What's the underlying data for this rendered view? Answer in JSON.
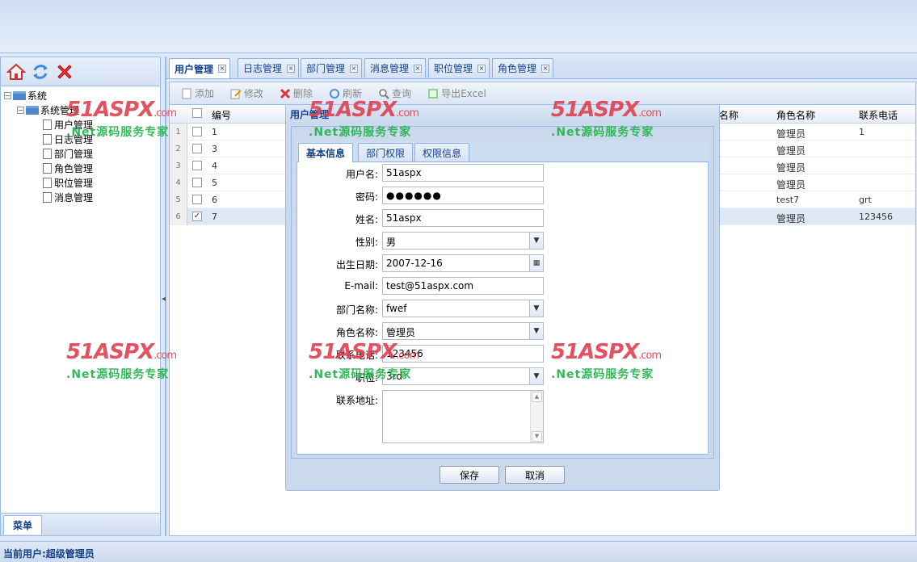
{
  "left": {
    "tree": {
      "root": "系统",
      "group": "系统管理",
      "items": [
        "用户管理",
        "日志管理",
        "部门管理",
        "角色管理",
        "职位管理",
        "消息管理"
      ]
    },
    "footer_tab": "菜单"
  },
  "tabs": [
    {
      "label": "用户管理",
      "active": true
    },
    {
      "label": "日志管理"
    },
    {
      "label": "部门管理"
    },
    {
      "label": "消息管理"
    },
    {
      "label": "职位管理"
    },
    {
      "label": "角色管理"
    }
  ],
  "toolbar": {
    "add": "添加",
    "edit": "修改",
    "delete": "删除",
    "refresh": "刷新",
    "query": "查询",
    "export": "导出Excel"
  },
  "grid": {
    "headers": {
      "id": "编号",
      "partial": "名称",
      "role": "角色名称",
      "phone": "联系电话"
    },
    "rows": [
      {
        "num": "1",
        "id": "1",
        "role": "管理员",
        "phone": "1"
      },
      {
        "num": "2",
        "id": "3",
        "role": "管理员",
        "phone": ""
      },
      {
        "num": "3",
        "id": "4",
        "role": "管理员",
        "phone": ""
      },
      {
        "num": "4",
        "id": "5",
        "role": "管理员",
        "phone": ""
      },
      {
        "num": "5",
        "id": "6",
        "role": "test7",
        "phone": "grt"
      },
      {
        "num": "6",
        "id": "7",
        "role": "管理员",
        "phone": "123456",
        "selected": true
      }
    ]
  },
  "dialog": {
    "title": "用户管理",
    "tabs": [
      "基本信息",
      "部门权限",
      "权限信息"
    ],
    "fields": {
      "username": {
        "label": "用户名:",
        "value": "51aspx"
      },
      "password": {
        "label": "密码:",
        "value": "●●●●●●"
      },
      "name": {
        "label": "姓名:",
        "value": "51aspx"
      },
      "gender": {
        "label": "性别:",
        "value": "男"
      },
      "birthday": {
        "label": "出生日期:",
        "value": "2007-12-16"
      },
      "email": {
        "label": "E-mail:",
        "value": "test@51aspx.com"
      },
      "dept": {
        "label": "部门名称:",
        "value": "fwef"
      },
      "role": {
        "label": "角色名称:",
        "value": "管理员"
      },
      "phone": {
        "label": "联系电话:",
        "value": "123456"
      },
      "position": {
        "label": "职位:",
        "value": "3rd"
      },
      "address": {
        "label": "联系地址:",
        "value": ""
      }
    },
    "save": "保存",
    "cancel": "取消"
  },
  "watermark": {
    "logo": "51ASPX",
    "domain": ".com",
    "slogan": ".Net源码服务专家"
  },
  "status": "当前用户:超级管理员",
  "colors": {
    "accent": "#15428b",
    "border": "#99bbe8",
    "panel": "#dfe8f6",
    "watermark_red": "#e04050",
    "watermark_green": "#22b04a"
  }
}
